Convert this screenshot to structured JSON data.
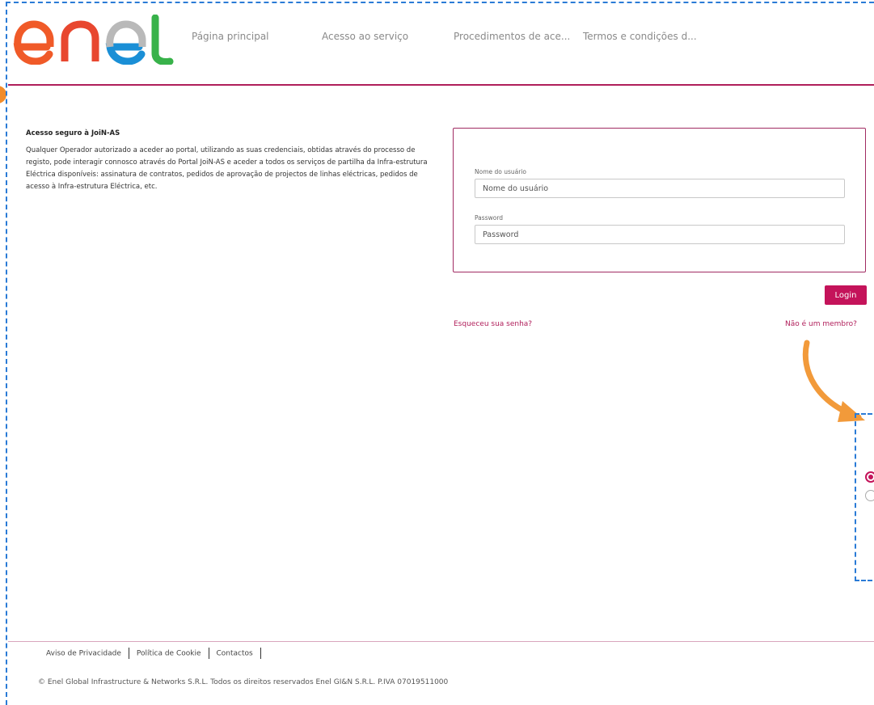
{
  "brand": {
    "logo_text": "enel",
    "colors": {
      "accent": "#c4135a",
      "rule": "#b01e5a",
      "logo_orange": "#f05a28",
      "logo_blue": "#1a8fd6",
      "logo_gray": "#b9b9b9",
      "logo_green": "#38b24a"
    }
  },
  "nav": {
    "items": [
      {
        "label": "Página principal"
      },
      {
        "label": "Acesso ao serviço"
      },
      {
        "label": "Procedimentos de ace..."
      },
      {
        "label": "Termos e condições d..."
      }
    ]
  },
  "intro": {
    "title": "Acesso seguro à JoiN-AS",
    "text": "Qualquer Operador autorizado a aceder ao portal, utilizando as suas credenciais, obtidas através do processo de registo, pode interagir connosco através do Portal JoiN-AS e aceder a todos os serviços de partilha da Infra-estrutura Eléctrica disponíveis: assinatura de contratos, pedidos de aprovação de projectos de linhas eléctricas, pedidos de acesso à Infra-estrutura Eléctrica, etc."
  },
  "login": {
    "username_label": "Nome do usuário",
    "username_placeholder": "Nome do usuário",
    "password_label": "Password",
    "password_placeholder": "Password",
    "button_label": "Login",
    "forgot_link": "Esqueceu sua senha?",
    "register_link": "Não é um membro?"
  },
  "footer": {
    "links": [
      {
        "label": "Aviso de Privacidade"
      },
      {
        "label": "Política de Cookie"
      },
      {
        "label": "Contactos"
      }
    ],
    "copyright": "© Enel Global Infrastructure & Networks S.R.L. Todos os direitos reservados Enel GI&N S.R.L. P.IVA 07019511000"
  }
}
